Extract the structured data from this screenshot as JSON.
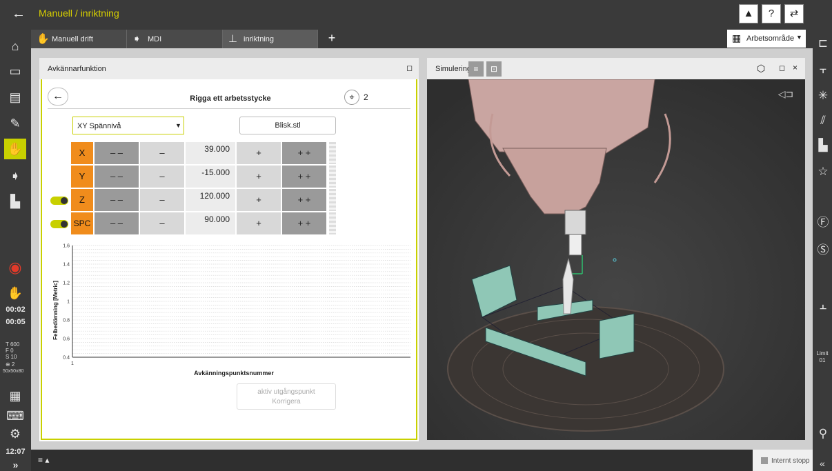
{
  "titlebar": {
    "title": "Manuell / inriktning"
  },
  "tabs": [
    {
      "label": "Manuell drift"
    },
    {
      "label": "MDI"
    },
    {
      "label": "inriktning"
    }
  ],
  "workspace": {
    "label": "Arbetsområde"
  },
  "probe_panel": {
    "title": "Avkännarfunktion",
    "heading": "Rigga ett arbetsstycke",
    "point_count": "2",
    "plane_select": "XY Spännivå",
    "file_button": "Blisk.stl",
    "step_labels": {
      "fast_minus": "– –",
      "minus": "–",
      "plus": "+",
      "fast_plus": "+ +"
    },
    "axes": [
      {
        "name": "X",
        "value": "39.000"
      },
      {
        "name": "Y",
        "value": "-15.000"
      },
      {
        "name": "Z",
        "value": "120.000"
      },
      {
        "name": "SPC",
        "value": "90.000"
      }
    ],
    "correct_button": {
      "line1": "aktiv utgångspunkt",
      "line2": "Korrigera"
    }
  },
  "chart_data": {
    "type": "scatter",
    "title": "",
    "xlabel": "Avkänningspunktsnummer",
    "ylabel": "Felbedömning [Metric]",
    "x_ticks": [
      "1"
    ],
    "y_ticks": [
      "0.4",
      "0.6",
      "0.8",
      "1",
      "1.2",
      "1.4",
      "1.6"
    ],
    "ylim": [
      0.4,
      1.6
    ],
    "grid": true,
    "series": []
  },
  "sim_panel": {
    "title": "Simulering"
  },
  "leftbar": {
    "time1": "00:02",
    "time2": "00:05",
    "status_T": "T   600",
    "status_F": "F      0",
    "status_S": "S     10",
    "status_P": "⊕    2",
    "status_size": "50x50x80",
    "clock": "12:07",
    "expand": "»"
  },
  "rightbar": {
    "limit_label": "Limit",
    "limit_value": "01",
    "collapse": "«"
  },
  "bottombar": {
    "menu": "≡ ▴",
    "stop_label": "Internt stopp"
  },
  "colors": {
    "accent": "#c8d000",
    "axis": "#f08c1c",
    "title": "#d8d000"
  }
}
